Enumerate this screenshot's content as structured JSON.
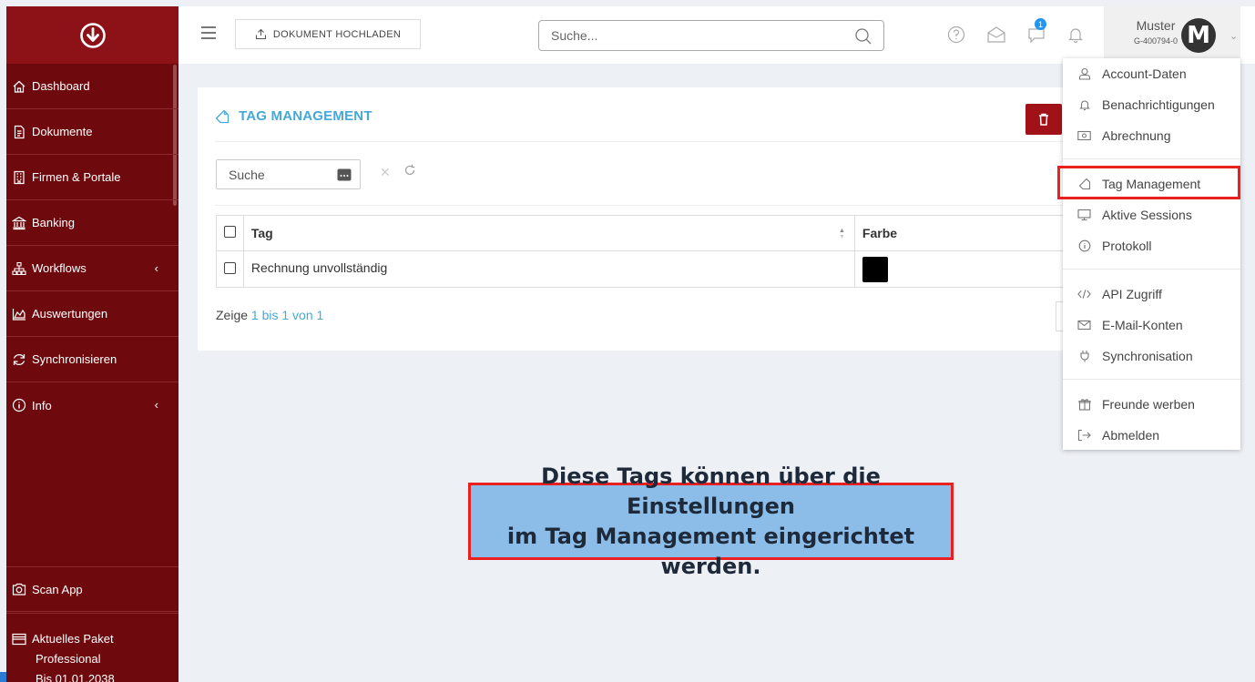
{
  "sidebar": {
    "items": [
      {
        "label": "Dashboard",
        "icon": "home-icon"
      },
      {
        "label": "Dokumente",
        "icon": "document-icon"
      },
      {
        "label": "Firmen & Portale",
        "icon": "building-icon"
      },
      {
        "label": "Banking",
        "icon": "bank-icon"
      },
      {
        "label": "Workflows",
        "icon": "sitemap-icon",
        "chevron": "‹"
      },
      {
        "label": "Auswertungen",
        "icon": "chart-area-icon"
      },
      {
        "label": "Synchronisieren",
        "icon": "sync-icon"
      },
      {
        "label": "Info",
        "icon": "info-icon",
        "chevron": "‹"
      }
    ],
    "scan_app": "Scan App",
    "paket": {
      "title": "Aktuelles Paket",
      "name": "Professional",
      "until": "Bis 01.01.2038"
    }
  },
  "topbar": {
    "upload_label": "DOKUMENT HOCHLADEN",
    "search_placeholder": "Suche...",
    "chat_badge": "1",
    "user_name": "Muster",
    "user_id": "G-400794-0",
    "avatar_letter": "M"
  },
  "card": {
    "title": "TAG MANAGEMENT",
    "search_placeholder": "Suche",
    "columns": {
      "tag": "Tag",
      "farbe": "Farbe"
    },
    "rows": [
      {
        "tag": "Rechnung unvollständig",
        "color": "#000000"
      }
    ],
    "info_prefix": "Zeige ",
    "info_highlight": "1 bis 1 von 1"
  },
  "dropdown": {
    "items": [
      {
        "label": "Account-Daten",
        "icon": "user-icon"
      },
      {
        "label": "Benachrichtigungen",
        "icon": "bell-icon"
      },
      {
        "label": "Abrechnung",
        "icon": "money-icon"
      },
      {
        "label": "Tag Management",
        "icon": "tag-icon"
      },
      {
        "label": "Aktive Sessions",
        "icon": "monitor-icon"
      },
      {
        "label": "Protokoll",
        "icon": "info-icon"
      },
      {
        "label": "API Zugriff",
        "icon": "code-icon"
      },
      {
        "label": "E-Mail-Konten",
        "icon": "envelope-icon"
      },
      {
        "label": "Synchronisation",
        "icon": "plug-icon"
      },
      {
        "label": "Freunde werben",
        "icon": "gift-icon"
      },
      {
        "label": "Abmelden",
        "icon": "logout-icon"
      }
    ]
  },
  "callout": {
    "line1": "Diese Tags können über die Einstellungen",
    "line2": "im Tag Management eingerichtet werden."
  },
  "colors": {
    "sidebar_bg": "#6e0a0e",
    "logo_bg": "#8c1217",
    "accent_blue": "#45a8d8",
    "delete_red": "#a11218",
    "highlight_red": "#e82020",
    "callout_bg": "#8bbde8"
  }
}
